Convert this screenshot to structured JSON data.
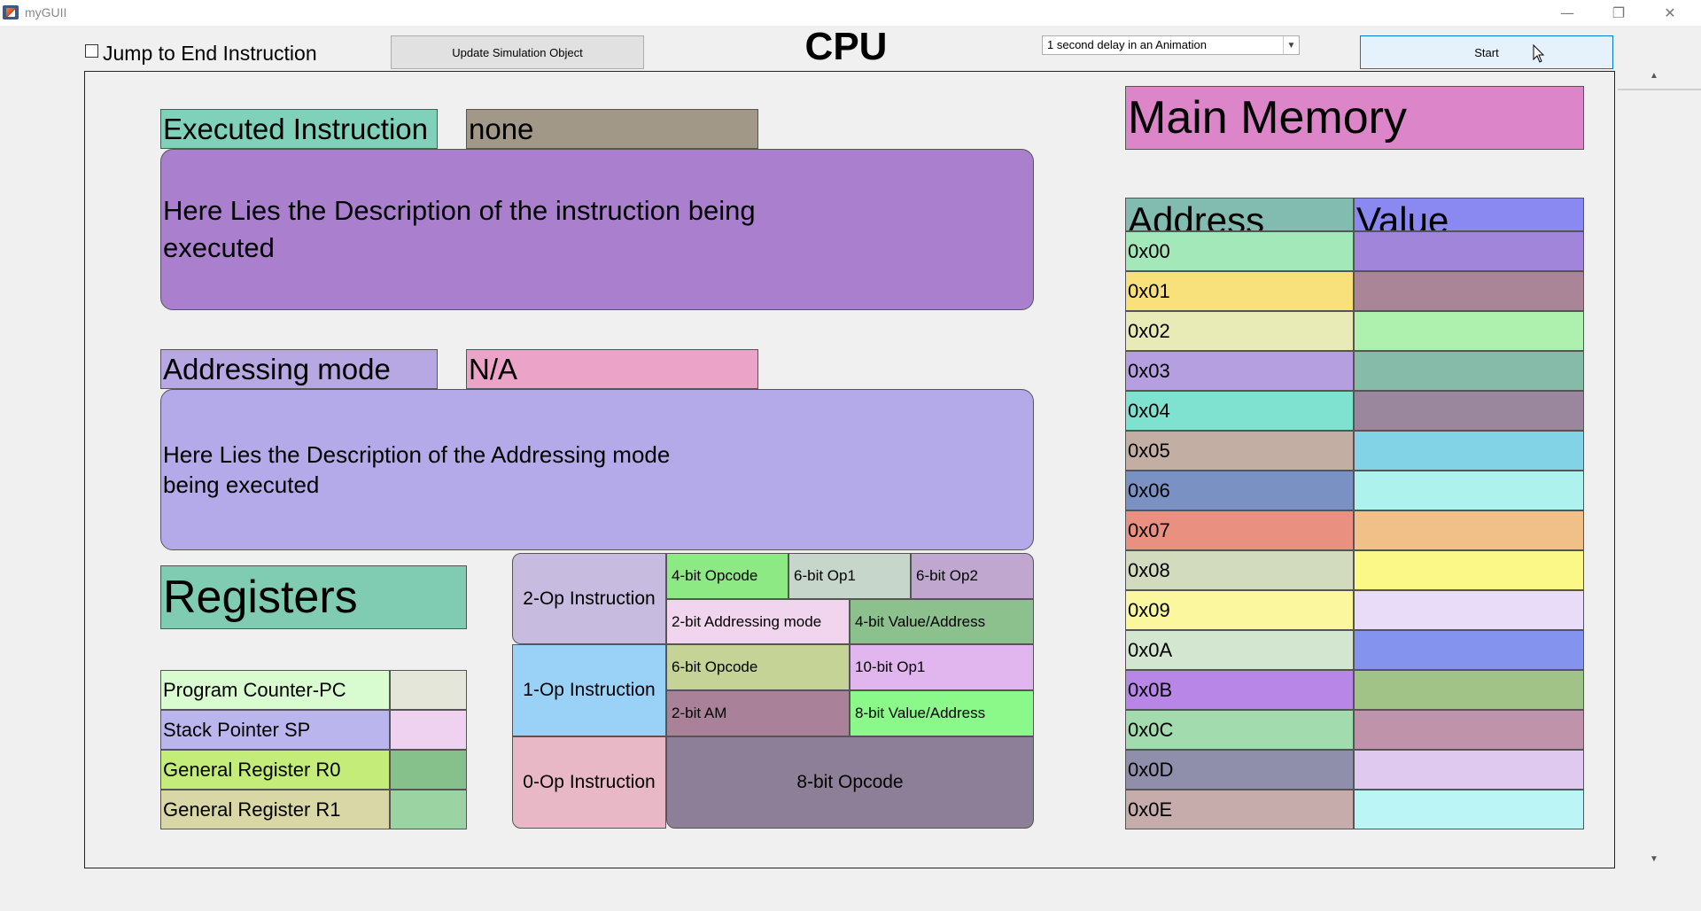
{
  "window": {
    "title": "myGUII",
    "minimize": "—",
    "restore": "❐",
    "close": "✕"
  },
  "toolbar": {
    "jump_label": "Jump to End Instruction",
    "update_label": "Update Simulation Object",
    "title": "CPU Simulation",
    "delay_selected": "1 second delay in an Animation",
    "start_label": "Start"
  },
  "instruction": {
    "executed_label": "Executed Instruction",
    "executed_value": "none",
    "description": "Here Lies the Description of the instruction being executed",
    "addressing_label": "Addressing mode",
    "addressing_value": "N/A",
    "addressing_description": "Here Lies the Description of the Addressing mode being executed"
  },
  "registers": {
    "title": "Registers",
    "items": [
      {
        "label": "Program Counter-PC",
        "label_color": "#d8fccf",
        "value_color": "#e3e6d8"
      },
      {
        "label": "Stack Pointer SP",
        "label_color": "#bbb5ee",
        "value_color": "#efd2ef"
      },
      {
        "label": "General Register R0",
        "label_color": "#c3ed78",
        "value_color": "#86c08a"
      },
      {
        "label": "General Register R1",
        "label_color": "#d8d7a5",
        "value_color": "#9bd3a2"
      }
    ]
  },
  "formats": {
    "two_op": {
      "label": "2-Op Instruction",
      "f1": "4-bit Opcode",
      "f2": "6-bit Op1",
      "f3": "6-bit Op2",
      "f4": "2-bit Addressing mode",
      "f5": "4-bit Value/Address"
    },
    "one_op": {
      "label": "1-Op Instruction",
      "f1": "6-bit Opcode",
      "f2": "10-bit Op1",
      "f3": "2-bit AM",
      "f4": "8-bit Value/Address"
    },
    "zero_op": {
      "label": "0-Op Instruction",
      "f1": "8-bit Opcode"
    }
  },
  "memory": {
    "title": "Main Memory",
    "address_header": "Address",
    "value_header": "Value",
    "rows": [
      {
        "address": "0x00",
        "addr_color": "#a2e8b8",
        "val_color": "#a085da"
      },
      {
        "address": "0x01",
        "addr_color": "#f8e17a",
        "val_color": "#a98597"
      },
      {
        "address": "0x02",
        "addr_color": "#e8ebb6",
        "val_color": "#aef1ae"
      },
      {
        "address": "0x03",
        "addr_color": "#b59fe0",
        "val_color": "#86bba9"
      },
      {
        "address": "0x04",
        "addr_color": "#7fe1cf",
        "val_color": "#9a869d"
      },
      {
        "address": "0x05",
        "addr_color": "#c2aea3",
        "val_color": "#82d3e5"
      },
      {
        "address": "0x06",
        "addr_color": "#7a91c4",
        "val_color": "#aef2ee"
      },
      {
        "address": "0x07",
        "addr_color": "#ea9080",
        "val_color": "#f1c088"
      },
      {
        "address": "0x08",
        "addr_color": "#d2dbbd",
        "val_color": "#fbf887"
      },
      {
        "address": "0x09",
        "addr_color": "#faf79f",
        "val_color": "#e8dcf8"
      },
      {
        "address": "0x0A",
        "addr_color": "#d3e6cf",
        "val_color": "#8494ee"
      },
      {
        "address": "0x0B",
        "addr_color": "#b786e6",
        "val_color": "#a1c388"
      },
      {
        "address": "0x0C",
        "addr_color": "#a2dbae",
        "val_color": "#bf93aa"
      },
      {
        "address": "0x0D",
        "addr_color": "#8f8eab",
        "val_color": "#e0c9ee"
      },
      {
        "address": "0x0E",
        "addr_color": "#c6acab",
        "val_color": "#bcf5f6"
      }
    ]
  }
}
